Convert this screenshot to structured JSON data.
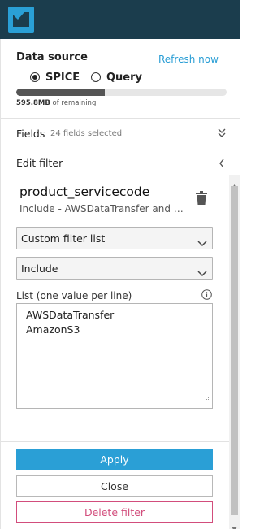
{
  "header": {
    "logo_icon": "quicksight-logo-icon"
  },
  "data_source": {
    "title": "Data source",
    "refresh_label": "Refresh now",
    "options": [
      {
        "label": "SPICE",
        "selected": true
      },
      {
        "label": "Query",
        "selected": false
      }
    ],
    "usage_fraction": 0.42,
    "remaining_amount": "595.8MB",
    "remaining_suffix": " of remaining"
  },
  "fields": {
    "label": "Fields",
    "count_text": "24 fields selected"
  },
  "edit_filter": {
    "title": "Edit filter",
    "field_name": "product_servicecode",
    "description": "Include - AWSDataTransfer and m...",
    "filter_type": "Custom filter list",
    "condition": "Include",
    "list_label": "List (one value per line)",
    "list_values": [
      "AWSDataTransfer",
      "AmazonS3"
    ]
  },
  "actions": {
    "apply": "Apply",
    "close": "Close",
    "delete": "Delete filter"
  },
  "colors": {
    "topbar": "#1b3d4d",
    "accent": "#2a9fd6",
    "danger": "#d24d7c"
  }
}
